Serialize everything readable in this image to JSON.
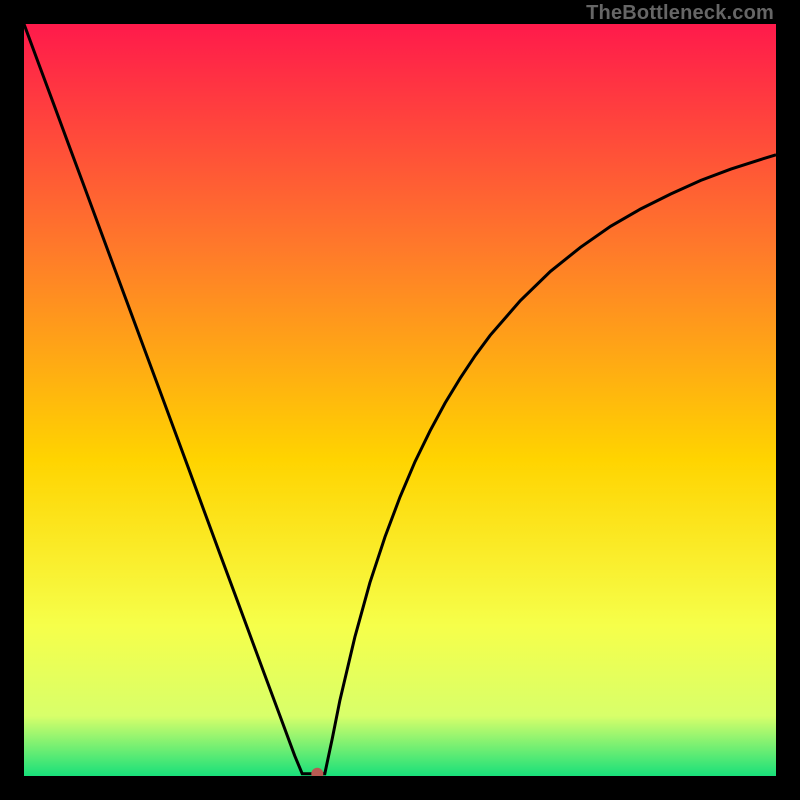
{
  "watermark": "TheBottleneck.com",
  "colors": {
    "top": "#ff1a4b",
    "mid_upper": "#ff7a2a",
    "mid": "#ffd400",
    "mid_lower": "#f6ff4a",
    "lower": "#d8ff6a",
    "bottom": "#18e07a",
    "curve": "#000000",
    "marker": "#b85a52",
    "background": "#000000"
  },
  "chart_data": {
    "type": "line",
    "title": "",
    "xlabel": "",
    "ylabel": "",
    "xlim": [
      0,
      100
    ],
    "ylim": [
      0,
      100
    ],
    "x": [
      0,
      2,
      4,
      6,
      8,
      10,
      12,
      14,
      16,
      18,
      20,
      22,
      24,
      26,
      28,
      30,
      32,
      34,
      36,
      37,
      38,
      39,
      40,
      41,
      42,
      44,
      46,
      48,
      50,
      52,
      54,
      56,
      58,
      60,
      62,
      66,
      70,
      74,
      78,
      82,
      86,
      90,
      94,
      98,
      100
    ],
    "values": [
      100,
      94.6,
      89.2,
      83.8,
      78.4,
      73.0,
      67.6,
      62.2,
      56.8,
      51.4,
      46.0,
      40.6,
      35.1,
      29.7,
      24.3,
      18.9,
      13.5,
      8.1,
      2.7,
      0.3,
      0.3,
      0.3,
      0.3,
      5.0,
      10.0,
      18.5,
      25.7,
      31.8,
      37.1,
      41.8,
      45.9,
      49.6,
      52.9,
      55.9,
      58.6,
      63.2,
      67.1,
      70.3,
      73.1,
      75.4,
      77.4,
      79.2,
      80.7,
      82.0,
      82.6
    ],
    "marker": {
      "x": 39,
      "y": 0.3
    },
    "notes": "V-shaped bottleneck curve. Left branch descends roughly linearly from (0,100) to a minimum near x≈37–40 at y≈0. Right branch rises with diminishing slope toward ~83 at x=100. Values are percentages estimated from the image (0–100 on both axes)."
  }
}
